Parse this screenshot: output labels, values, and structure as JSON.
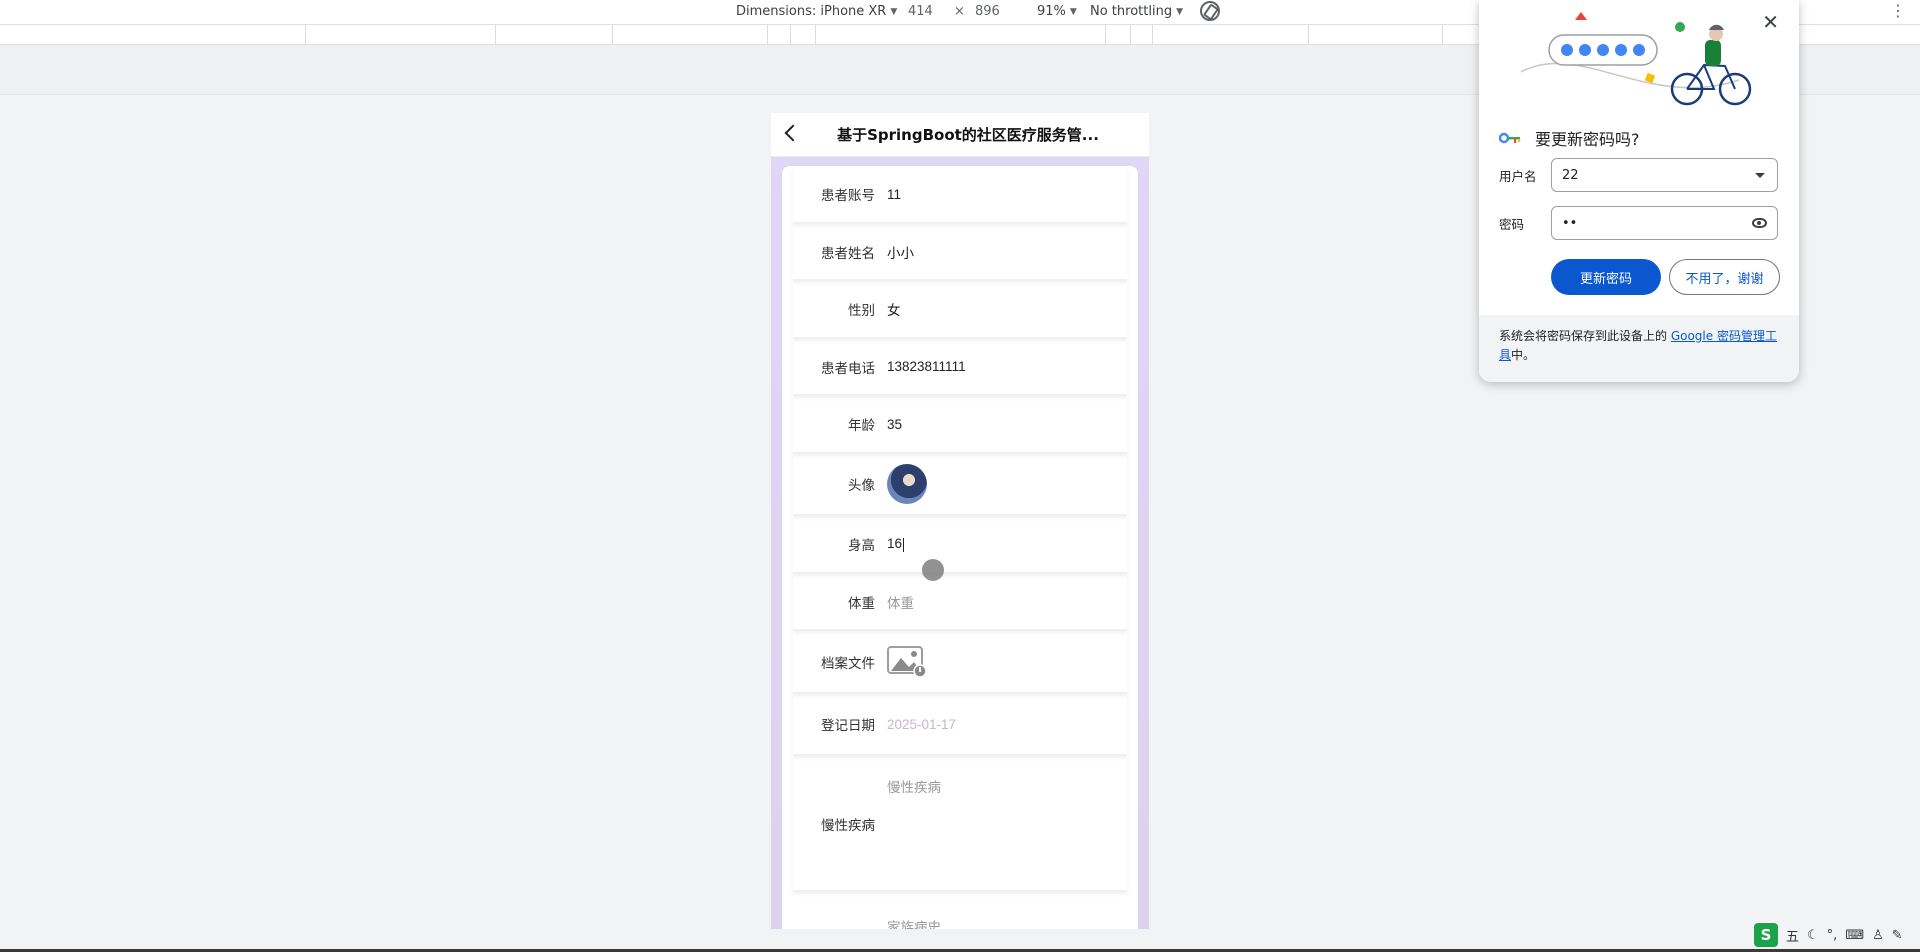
{
  "devtools": {
    "dimensions_label": "Dimensions: iPhone XR",
    "width": "414",
    "times": "×",
    "height": "896",
    "zoom": "91%",
    "throttling": "No throttling"
  },
  "phone": {
    "title": "基于SpringBoot的社区医疗服务管...",
    "rows": [
      {
        "label": "患者账号",
        "value": "11"
      },
      {
        "label": "患者姓名",
        "value": "小小"
      },
      {
        "label": "性别",
        "value": "女"
      },
      {
        "label": "患者电话",
        "value": "13823811111"
      },
      {
        "label": "年龄",
        "value": "35"
      },
      {
        "label": "头像",
        "value": ""
      },
      {
        "label": "身高",
        "value": "16"
      },
      {
        "label": "体重",
        "placeholder": "体重"
      },
      {
        "label": "档案文件",
        "value": ""
      },
      {
        "label": "登记日期",
        "value": "2025-01-17"
      },
      {
        "label": "慢性疾病",
        "placeholder": "慢性疾病"
      },
      {
        "label": "",
        "placeholder": "家族病史"
      }
    ]
  },
  "password_bubble": {
    "title": "要更新密码吗?",
    "username_label": "用户名",
    "username_value": "22",
    "password_label": "密码",
    "password_value": "••",
    "update_button": "更新密码",
    "decline_button": "不用了，谢谢",
    "footer_prefix": "系统会将密码保存到此设备上的 ",
    "footer_link": "Google 密码管理工具",
    "footer_suffix": "中。"
  },
  "ime": {
    "logo": "S",
    "mode": "五",
    "punct": "°,"
  },
  "colors": {
    "primary_blue": "#0b57d0",
    "phone_bg": "#ded7f5",
    "date_text": "#c9b4d3"
  }
}
